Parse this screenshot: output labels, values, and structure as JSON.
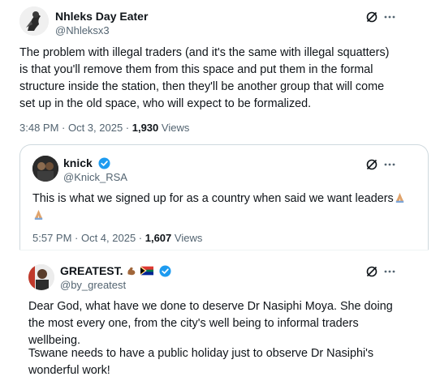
{
  "tweet1": {
    "name": "Nhleks Day Eater",
    "handle": "@Nhleksx3",
    "text": "The problem with illegal traders (and it's the same with illegal squatters) is that you'll remove them from this space and put them in the formal structure inside the station, then they'll be another group that will come set up in the old space, who will expect to be formalized.",
    "time": "3:48 PM · Oct 3, 2025 · ",
    "views_count": "1,930",
    "views_label": " Views"
  },
  "tweet2": {
    "name": "knick",
    "handle": "@Knick_RSA",
    "text": "This is what we signed up for as a country when said we want leaders",
    "time": "5:57 PM · Oct 4, 2025 · ",
    "views_count": "1,607",
    "views_label": " Views"
  },
  "tweet3": {
    "name": "GREATEST.",
    "handle": "@by_greatest",
    "text_p1": "Dear God, what have we done to deserve Dr Nasiphi Moya. She doing the most every one, from the city's well being to informal traders wellbeing.",
    "text_p2": "Tswane needs to have a public holiday just to observe Dr Nasiphi's wonderful work!"
  },
  "icons": {
    "grok": "grok-icon",
    "more": "more-icon",
    "verified": "verified-icon",
    "verified_color": "#1d9bf0"
  }
}
